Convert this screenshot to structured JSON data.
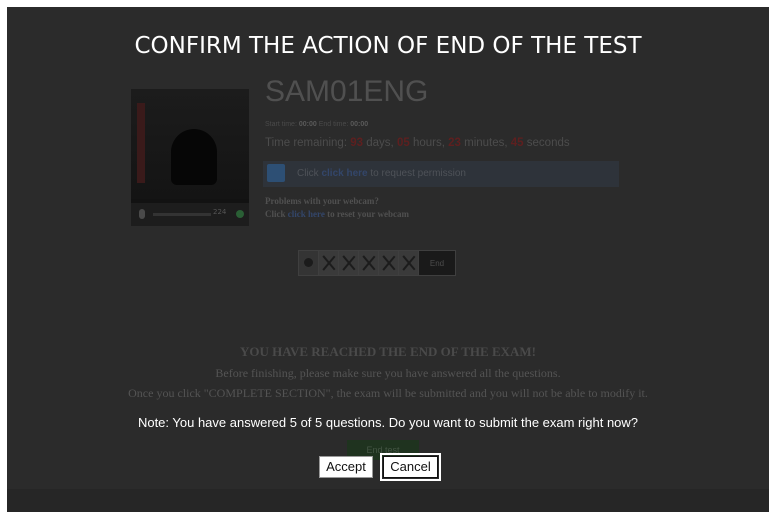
{
  "dialog": {
    "title": "CONFIRM THE ACTION OF END OF THE TEST",
    "note": "Note: You have answered 5 of 5 questions. Do you want to submit the exam right now?",
    "accept_label": "Accept",
    "cancel_label": "Cancel"
  },
  "exam": {
    "code": "SAM01ENG",
    "start_label": "Start time:",
    "start_value": "00:00",
    "end_label": "End time:",
    "end_value": "00:00",
    "remaining_label": "Time remaining:",
    "days": "93",
    "days_unit": "days,",
    "hours": "05",
    "hours_unit": "hours,",
    "minutes": "23",
    "minutes_unit": "minutes,",
    "seconds": "45",
    "seconds_unit": "seconds"
  },
  "permission": {
    "prefix": "Click",
    "link": "click here",
    "suffix": "to request permission"
  },
  "webcam": {
    "problems_text": "Problems with your webcam?",
    "reset_prefix": "Click",
    "reset_link": "click here",
    "reset_suffix": "to reset your webcam",
    "level_value": "224",
    "level_fraction": 0.0
  },
  "question_nav": {
    "end_label": "End",
    "questions": [
      "q1",
      "q2",
      "q3",
      "q4",
      "q5"
    ]
  },
  "end_section": {
    "heading": "YOU HAVE REACHED THE END OF THE EXAM!",
    "line1": "Before finishing, please make sure you have answered all the questions.",
    "line2": "Once you click \"COMPLETE SECTION\", the exam will be submitted and you will not be able to modify it.",
    "button_label": "End test"
  },
  "colors": {
    "overlay": "#2b2b2b",
    "time_number": "#8b1a1a",
    "link": "#1f4fa5",
    "end_button": "#2e7d32"
  },
  "icons": {
    "permission": "hand-permission-icon",
    "mic": "microphone-icon",
    "status": "status-dot-icon",
    "info": "info-icon",
    "answered": "cross-icon"
  }
}
